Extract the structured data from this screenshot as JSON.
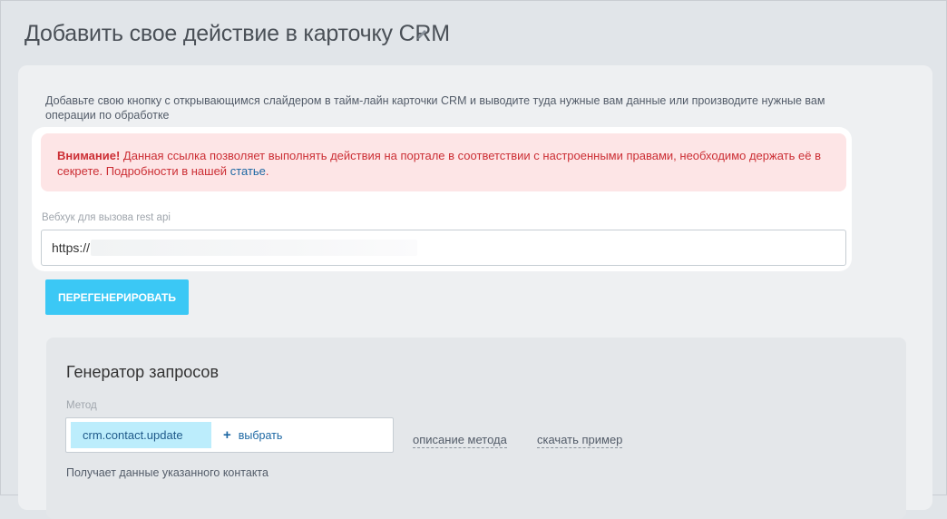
{
  "page": {
    "title": "Добавить свое действие в карточку CRM",
    "edit_icon": "pencil-icon"
  },
  "intro": {
    "description": "Добавьте свою кнопку с открывающимся слайдером в тайм-лайн карточки CRM и выводите туда нужные вам данные или производите нужные вам операции по обработке"
  },
  "alert": {
    "strong": "Внимание!",
    "text": " Данная ссылка позволяет выполнять действия на портале в соответствии с настроенными правами, необходимо держать её в секрете. Подробности в нашей ",
    "link": "статье",
    "tail": "."
  },
  "webhook": {
    "label": "Вебхук для вызова rest api",
    "value": "https://"
  },
  "buttons": {
    "regenerate": "ПЕРЕГЕНЕРИРОВАТЬ"
  },
  "generator": {
    "title": "Генератор запросов",
    "method_label": "Метод",
    "method_value": "crm.contact.update",
    "select_label": "выбрать",
    "method_description_link": "описание метода",
    "download_example_link": "скачать пример",
    "method_description": "Получает данные указанного контакта"
  },
  "colors": {
    "accent": "#3bc8f5",
    "alert_bg": "#fde5e6",
    "alert_text": "#cc2f35",
    "link": "#1c67a3"
  }
}
